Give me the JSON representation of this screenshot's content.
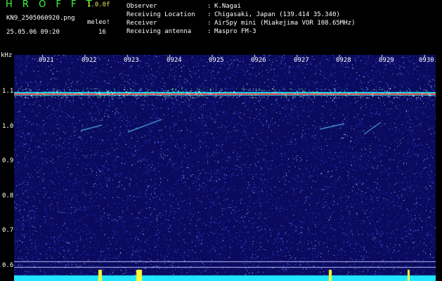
{
  "header": {
    "app_title": "H R O F F T",
    "version": "1.0.0f",
    "filename": "KN9_2505060920.png",
    "receiver_short": "meleo!",
    "datetime": "25.05.06 09:20",
    "count": "16"
  },
  "info": [
    {
      "key": "Observer",
      "value": "K.Nagai"
    },
    {
      "key": "Receiving Location",
      "value": "Chigasaki, Japan (139.414 35.340)"
    },
    {
      "key": "Receiver",
      "value": "AirSpy mini (Miakejima VOR 108.65MHz)"
    },
    {
      "key": "Receiving antenna",
      "value": "Maspro FM-3"
    }
  ],
  "info_separator": ":",
  "spectrogram": {
    "unit": "kHz",
    "y_ticks": [
      "1.1",
      "1.0",
      "0.9",
      "0.8",
      "0.7",
      "0.6"
    ],
    "x_ticks": [
      "0921",
      "0922",
      "0923",
      "0924",
      "0925",
      "0926",
      "0927",
      "0928",
      "0929",
      "0930"
    ],
    "colors": {
      "background": "#0a0a5e",
      "carrier": "#ff2a2a",
      "noise": "#3a5cff",
      "baseline": "#1ee6ff",
      "burst": "#ffff33"
    }
  }
}
